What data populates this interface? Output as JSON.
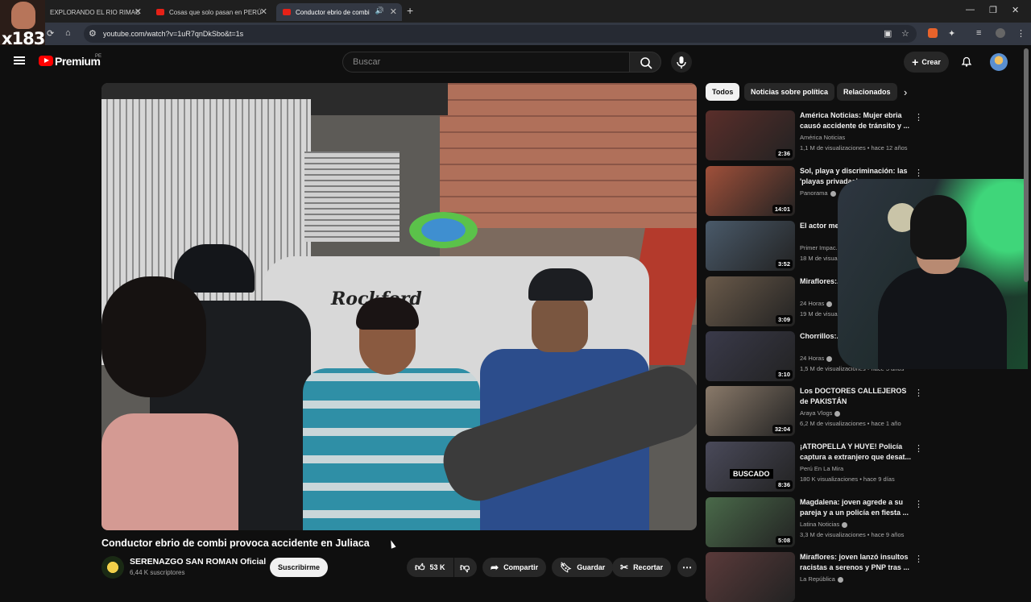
{
  "browser": {
    "tabs": [
      {
        "title": "EXPLORANDO EL RIO RIMAC",
        "active": false
      },
      {
        "title": "Cosas que solo pasan en PERÚ",
        "active": false
      },
      {
        "title": "Conductor ebrio de combi",
        "active": true
      }
    ],
    "url": "youtube.com/watch?v=1uR7qnDkSbo&t=1s"
  },
  "overlay": {
    "badge_text": "x183"
  },
  "header": {
    "logo_text": "Premium",
    "logo_region": "PE",
    "search_placeholder": "Buscar",
    "create_label": "Crear"
  },
  "video": {
    "title": "Conductor ebrio de combi provoca accidente en Juliaca",
    "channel": "SERENAZGO SAN ROMAN Oficial",
    "subscribers": "6,44 K suscriptores",
    "subscribe_label": "Suscribirme",
    "likes": "53 K",
    "share_label": "Compartir",
    "save_label": "Guardar",
    "clip_label": "Recortar",
    "watermark_text": "Rockford"
  },
  "chips": [
    {
      "label": "Todos",
      "active": true
    },
    {
      "label": "Noticias sobre política",
      "active": false
    },
    {
      "label": "Relacionados",
      "active": false
    }
  ],
  "recommendations": [
    {
      "title": "América Noticias: Mujer ebria causó accidente de tránsito y ...",
      "channel": "América Noticias",
      "meta": "1,1 M de visualizaciones • hace 12 años",
      "duration": "2:36",
      "verified": false,
      "thumb": "#5a2e2a"
    },
    {
      "title": "Sol, playa y discriminación: las 'playas privadas' ...",
      "channel": "Panorama",
      "meta": "",
      "duration": "14:01",
      "verified": true,
      "thumb": "#a0503a"
    },
    {
      "title": "El actor me... Yañez pier...",
      "channel": "Primer Impac...",
      "meta": "18 M de visua...",
      "duration": "3:52",
      "verified": false,
      "thumb": "#4a5a6a"
    },
    {
      "title": "Miraflores:... forma racis...",
      "channel": "24 Horas",
      "meta": "19 M de visua...",
      "duration": "3:09",
      "verified": true,
      "thumb": "#6a5a4a"
    },
    {
      "title": "Chorrillos:... llanto tras e...",
      "channel": "24 Horas",
      "meta": "1,5 M de visualizaciones • hace 5 años",
      "duration": "3:10",
      "verified": true,
      "thumb": "#3a3a4a"
    },
    {
      "title": "Los DOCTORES CALLEJEROS de PAKISTÁN",
      "channel": "Araya Vlogs",
      "meta": "6,2 M de visualizaciones • hace 1 año",
      "duration": "32:04",
      "verified": true,
      "thumb": "#8a7a6a"
    },
    {
      "title": "¡ATROPELLA Y HUYE! Policía captura a extranjero que desat...",
      "channel": "Perú En La Mira",
      "meta": "180 K visualizaciones • hace 9 días",
      "duration": "8:36",
      "verified": false,
      "thumb": "#4a4a5a",
      "badge": "BUSCADO"
    },
    {
      "title": "Magdalena: joven agrede a su pareja y a un policía en fiesta ...",
      "channel": "Latina Noticias",
      "meta": "3,3 M de visualizaciones • hace 9 años",
      "duration": "5:08",
      "verified": true,
      "thumb": "#4a6a4a"
    },
    {
      "title": "Miraflores: joven lanzó insultos racistas a serenos y PNP tras ...",
      "channel": "La República",
      "meta": "",
      "duration": "",
      "verified": true,
      "thumb": "#5a3a3a"
    }
  ],
  "colors": {
    "accent": "#ff0000",
    "background": "#0f0f0f",
    "chip_bg": "#272727"
  }
}
